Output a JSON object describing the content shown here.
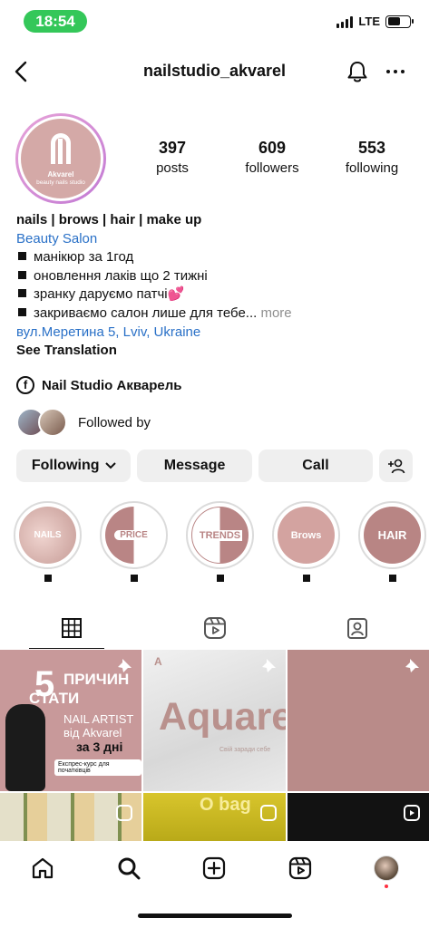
{
  "status_bar": {
    "time": "18:54",
    "network": "LTE",
    "battery_level": 0.6
  },
  "header": {
    "username": "nailstudio_akvarel"
  },
  "avatar": {
    "brand": "Akvarel",
    "subtitle": "beauty nails studio"
  },
  "stats": [
    {
      "value": "397",
      "label": "posts"
    },
    {
      "value": "609",
      "label": "followers"
    },
    {
      "value": "553",
      "label": "following"
    }
  ],
  "bio": {
    "name": "nails | brows | hair | make up",
    "category": "Beauty Salon",
    "lines": [
      "манікюр за 1год",
      "оновлення лаків що 2 тижні",
      "зранку даруємо патчі"
    ],
    "line4": "закриваємо салон лише для тебе...",
    "more": "more",
    "address": "вул.Меретина 5, Lviv, Ukraine",
    "see_translation": "See Translation"
  },
  "facebook_link": "Nail Studio Акварель",
  "followed_by": "Followed by",
  "buttons": {
    "following": "Following",
    "message": "Message",
    "call": "Call"
  },
  "highlights": [
    {
      "label": "NAILS"
    },
    {
      "label": "PRICE"
    },
    {
      "label": "TRENDS"
    },
    {
      "label": "Brows"
    },
    {
      "label": "HAIR"
    }
  ],
  "posts": {
    "p1": {
      "number": "5",
      "line1": "ПРИЧИН",
      "line2": "СТАТИ",
      "line3": "NAIL ARTIST",
      "line4": "від Akvarel",
      "line5": "за 3 дні",
      "line6": "Експрес-курс для початківців"
    },
    "p2": {
      "logo": "A",
      "word": "Aquarel",
      "tagline": "Свій заради себе"
    },
    "p5": {
      "text": "O bag"
    }
  },
  "colors": {
    "link": "#2970c7",
    "status_green": "#34c759",
    "button_bg": "#efefef",
    "brand_rose": "#b98585"
  }
}
